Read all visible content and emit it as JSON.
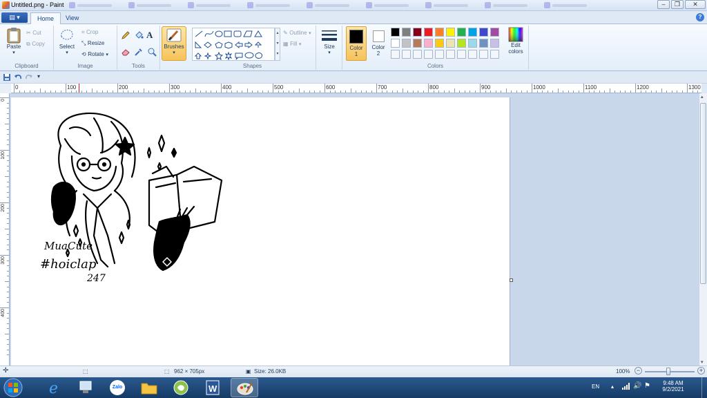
{
  "window": {
    "title": "Untitled.png - Paint"
  },
  "window_controls": {
    "minimize": "–",
    "restore": "❐",
    "close": "✕"
  },
  "menu_button": {
    "label": "▤ ▾"
  },
  "tabs": [
    {
      "label": "Home",
      "active": true
    },
    {
      "label": "View",
      "active": false
    }
  ],
  "help": "?",
  "clipboard": {
    "paste": "Paste",
    "cut": "Cut",
    "copy": "Copy",
    "group": "Clipboard"
  },
  "image": {
    "select": "Select",
    "crop": "Crop",
    "resize": "Resize",
    "rotate": "Rotate",
    "group": "Image"
  },
  "tools": {
    "group": "Tools",
    "text_tool": "A"
  },
  "brushes": {
    "label": "Brushes"
  },
  "shapes": {
    "outline": "Outline",
    "fill": "Fill",
    "group": "Shapes"
  },
  "size": {
    "label": "Size"
  },
  "colors": {
    "color1_label": "Color",
    "color1_num": "1",
    "color2_label": "Color",
    "color2_num": "2",
    "edit_label_1": "Edit",
    "edit_label_2": "colors",
    "group": "Colors",
    "color1": "#000000",
    "color2": "#ffffff",
    "palette_row1": [
      "#000000",
      "#7f7f7f",
      "#880015",
      "#ed1c24",
      "#ff7f27",
      "#fff200",
      "#22b14c",
      "#00a2e8",
      "#3f48cc",
      "#a349a4"
    ],
    "palette_row2": [
      "#ffffff",
      "#c3c3c3",
      "#b97a57",
      "#ffaec9",
      "#ffc90e",
      "#efe4b0",
      "#b5e61d",
      "#99d9ea",
      "#7092be",
      "#c8bfe7"
    ],
    "palette_row3_empty": 10
  },
  "ruler_h": [
    "0",
    "100",
    "200",
    "300",
    "400",
    "500",
    "600",
    "700",
    "800",
    "900",
    "1000",
    "1100",
    "1200",
    "1300"
  ],
  "ruler_v": [
    "0",
    "100",
    "200",
    "300",
    "400"
  ],
  "drawing": {
    "signature_line1": "MuaCute",
    "signature_line2": "#hoiclap",
    "signature_line3": "247"
  },
  "status": {
    "dimensions": "962 × 705px",
    "size": "Size: 26.0KB",
    "zoom": "100%"
  },
  "taskbar": {
    "zalo": "Zalo",
    "lang": "EN",
    "time": "9:48 AM",
    "date": "9/2/2021"
  }
}
